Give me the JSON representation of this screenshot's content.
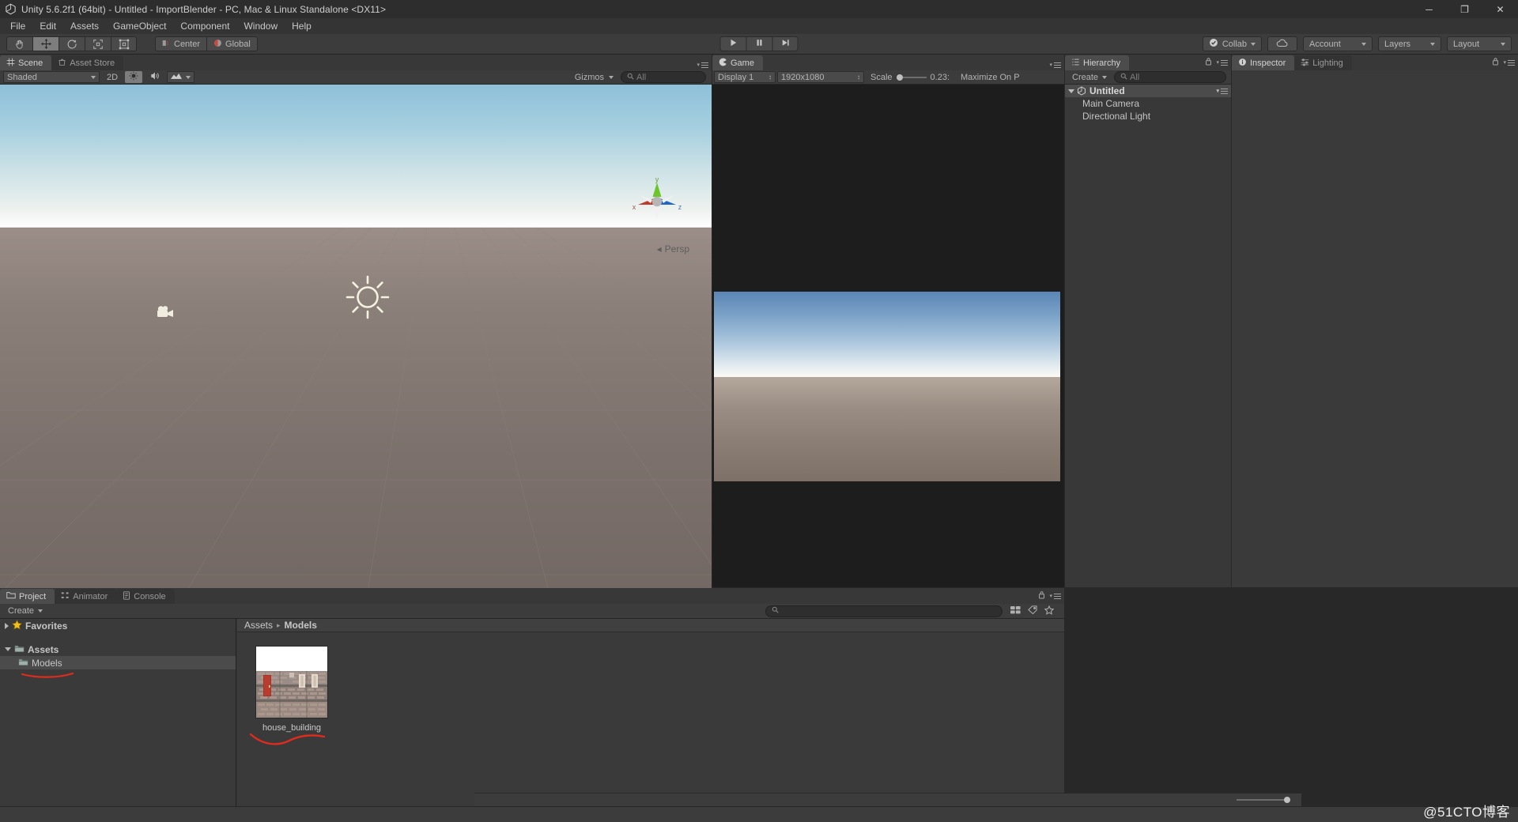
{
  "window": {
    "title": "Unity 5.6.2f1 (64bit) - Untitled - ImportBlender - PC, Mac & Linux Standalone <DX11>",
    "logo_icon": "unity-logo-icon",
    "minimize_label": "─",
    "maximize_label": "❐",
    "close_label": "✕"
  },
  "menubar": {
    "items": [
      {
        "label": "File"
      },
      {
        "label": "Edit"
      },
      {
        "label": "Assets"
      },
      {
        "label": "GameObject"
      },
      {
        "label": "Component"
      },
      {
        "label": "Window"
      },
      {
        "label": "Help"
      }
    ]
  },
  "toolbar": {
    "transform_tools": [
      {
        "name": "hand-tool",
        "icon": "hand-icon",
        "active": false
      },
      {
        "name": "move-tool",
        "icon": "move-arrows-icon",
        "active": true
      },
      {
        "name": "rotate-tool",
        "icon": "rotate-icon",
        "active": false
      },
      {
        "name": "scale-tool",
        "icon": "scale-icon",
        "active": false
      },
      {
        "name": "rect-tool",
        "icon": "rect-transform-icon",
        "active": false
      }
    ],
    "pivot_label": "Center",
    "pivot_icon": "pivot-center-icon",
    "space_label": "Global",
    "space_icon": "globe-icon",
    "play_label": "▶",
    "pause_label": "Ⅱ",
    "step_label": "▶|",
    "collab_label": "Collab",
    "collab_icon": "cloud-check-icon",
    "cloud_icon": "cloud-icon",
    "account_label": "Account",
    "layers_label": "Layers",
    "layout_label": "Layout"
  },
  "scene_panel": {
    "tabs": [
      {
        "label": "Scene",
        "icon": "scene-grid-icon",
        "active": true
      },
      {
        "label": "Asset Store",
        "icon": "store-bag-icon",
        "active": false
      }
    ],
    "draw_mode": "Shaded",
    "mode_2d": "2D",
    "lighting_icon": "sun-icon",
    "audio_icon": "speaker-icon",
    "effects_icon": "effects-icon",
    "gizmos_label": "Gizmos",
    "search_placeholder": "All",
    "search_value": "",
    "search_icon": "search-icon",
    "perspective_label": "Persp",
    "gizmo_axes": {
      "x": "x",
      "y": "y",
      "z": "z"
    },
    "gizmo_colors": {
      "x": "#c0392b",
      "y": "#62c223",
      "z": "#1f66c7"
    }
  },
  "game_panel": {
    "tabs": [
      {
        "label": "Game",
        "icon": "game-pacman-icon",
        "active": true
      }
    ],
    "display_label": "Display 1",
    "resolution_label": "1920x1080",
    "scale_label": "Scale",
    "scale_value": "0.23:",
    "maximize_label": "Maximize On P",
    "scale_slider_pct": 6
  },
  "hierarchy_panel": {
    "tabs": [
      {
        "label": "Hierarchy",
        "icon": "hierarchy-list-icon",
        "active": true
      }
    ],
    "create_label": "Create",
    "search_placeholder": "All",
    "search_value": "",
    "scene_name": "Untitled",
    "scene_icon": "unity-scene-icon",
    "objects": [
      {
        "label": "Main Camera"
      },
      {
        "label": "Directional Light"
      }
    ]
  },
  "inspector_panel": {
    "tabs": [
      {
        "label": "Inspector",
        "icon": "info-circle-icon",
        "active": true
      },
      {
        "label": "Lighting",
        "icon": "lighting-sliders-icon",
        "active": false
      }
    ]
  },
  "project_panel": {
    "tabs": [
      {
        "label": "Project",
        "icon": "folder-icon",
        "active": true
      },
      {
        "label": "Animator",
        "icon": "animator-nodes-icon",
        "active": false
      },
      {
        "label": "Console",
        "icon": "console-log-icon",
        "active": false
      }
    ],
    "create_label": "Create",
    "search_placeholder": "",
    "search_value": "",
    "filter_icons": [
      {
        "name": "type-filter-icon"
      },
      {
        "name": "label-filter-icon"
      },
      {
        "name": "favorite-filter-icon"
      }
    ],
    "tree": [
      {
        "label": "Favorites",
        "icon": "star-icon",
        "depth": 0,
        "fold": "closed",
        "selected": false
      },
      {
        "label": "Assets",
        "icon": "folder-icon",
        "depth": 0,
        "fold": "open",
        "selected": false
      },
      {
        "label": "Models",
        "icon": "folder-icon",
        "depth": 1,
        "fold": "none",
        "selected": true
      }
    ],
    "breadcrumb": [
      "Assets",
      "Models"
    ],
    "breadcrumb_sep": "▸",
    "assets": [
      {
        "label": "house_building",
        "thumb": "brick-house-texture"
      }
    ],
    "zoom_value": 12
  },
  "statusbar": {
    "watermark": "@51CTO博客"
  },
  "colors": {
    "accent_selection": "#4b4b4b",
    "panel_bg": "#383838",
    "toolbar_bg": "#3c3c3c",
    "annotation_red": "#e02b1d"
  }
}
